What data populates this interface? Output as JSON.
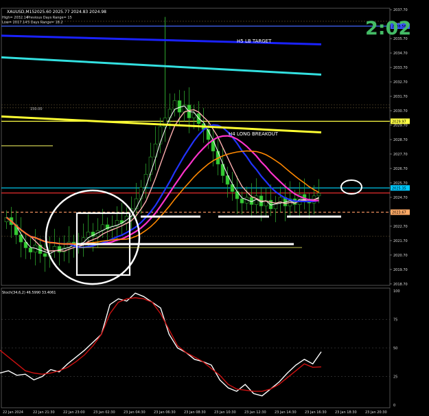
{
  "header": {
    "symbol": "XAUUSD,M15",
    "ohlc": "2025.60 2025.77 2024.83 2024.98",
    "info_high": "High= 2032.14",
    "info_prev": "Previous Days Range= 15",
    "info_low": "Low= 2017.14",
    "info_5d": "5 Days Range= 18.2",
    "countdown": "2:02",
    "indicator_title": "Stoch(34,6,2) 46.5990 33.4061"
  },
  "annotations": {
    "h5_target": "H5 LB TARGET",
    "h4_breakout": "H4 LONG BREAKOUT",
    "level_label": "150.00"
  },
  "chart_data": [
    {
      "type": "candlestick",
      "title": "XAUUSD,M15",
      "ylim": [
        2018.6,
        2037.8
      ],
      "y_ticks": [
        "2037.70",
        "2036.70",
        "2035.70",
        "2034.70",
        "2033.70",
        "2032.70",
        "2031.70",
        "2030.70",
        "2029.70",
        "2028.70",
        "2027.70",
        "2026.70",
        "2025.70",
        "2024.70",
        "2023.70",
        "2022.70",
        "2021.70",
        "2020.70",
        "2019.70",
        "2018.70"
      ],
      "price_tags": [
        {
          "value": "2036.56",
          "price": 2036.56,
          "color": "#3a55ff"
        },
        {
          "value": "2029.97",
          "price": 2029.97,
          "color": "#ffff44"
        },
        {
          "value": "2025.35",
          "price": 2025.35,
          "color": "#00c8ff"
        },
        {
          "value": "2023.67",
          "price": 2023.67,
          "color": "#ffaa66"
        }
      ],
      "x_ticks": [
        "22 Jan 2024",
        "22 Jan 21:30",
        "22 Jan 23:00",
        "23 Jan 02:30",
        "23 Jan 04:30",
        "23 Jan 06:30",
        "23 Jan 08:30",
        "23 Jan 10:30",
        "23 Jan 12:30",
        "23 Jan 14:30",
        "23 Jan 16:30",
        "23 Jan 18:30",
        "23 Jan 20:30"
      ],
      "closes": [
        2023.3,
        2022.8,
        2022.1,
        2021.6,
        2021.2,
        2020.9,
        2021.4,
        2020.8,
        2020.6,
        2021.0,
        2021.3,
        2020.9,
        2021.2,
        2021.6,
        2021.3,
        2021.5,
        2021.9,
        2022.3,
        2022.0,
        2022.4,
        2022.8,
        2022.5,
        2022.7,
        2023.1,
        2022.9,
        2023.4,
        2023.9,
        2024.6,
        2025.4,
        2026.3,
        2027.5,
        2028.4,
        2029.6,
        2030.2,
        2030.8,
        2031.4,
        2030.6,
        2031.1,
        2030.2,
        2030.5,
        2029.8,
        2029.4,
        2028.7,
        2027.9,
        2027.0,
        2026.2,
        2025.6,
        2025.1,
        2024.6,
        2024.3,
        2024.7,
        2024.2,
        2024.8,
        2024.1,
        2024.5,
        2023.9,
        2024.3,
        2024.7,
        2024.1,
        2024.6,
        2024.2,
        2024.9,
        2024.5,
        2024.3,
        2024.8,
        2024.98
      ],
      "vertical_lines": [
        {
          "name": "ema-blue",
          "color": "#1a22ff",
          "from": 2035.9,
          "to": 2035.3
        },
        {
          "name": "ema-cyan",
          "color": "#33e0e0",
          "from": 2034.4,
          "to": 2033.2
        },
        {
          "name": "ema-yellow",
          "color": "#ffff33",
          "from": 2030.3,
          "to": 2029.2
        }
      ],
      "levels": [
        {
          "price": 2036.56,
          "color": "#4466ff"
        },
        {
          "price": 2029.97,
          "color": "#ffff44"
        },
        {
          "price": 2025.35,
          "color": "#00d8ff"
        },
        {
          "price": 2023.67,
          "color": "#ff9966"
        },
        {
          "price": 2025.0,
          "color": "#ff3333"
        }
      ]
    },
    {
      "type": "line",
      "title": "Stoch(34,6,2) 46.5990 33.4061",
      "ylim": [
        0,
        100
      ],
      "y_ticks": [
        "100",
        "75",
        "50",
        "25",
        "0"
      ],
      "series": [
        {
          "color": "#ffffff",
          "values": [
            28,
            30,
            26,
            27,
            22,
            25,
            31,
            29,
            36,
            42,
            48,
            55,
            62,
            88,
            93,
            91,
            98,
            95,
            90,
            85,
            62,
            50,
            46,
            40,
            38,
            35,
            22,
            15,
            12,
            18,
            10,
            8,
            14,
            20,
            28,
            35,
            40,
            36,
            46.6
          ]
        },
        {
          "color": "#cc1111",
          "values": [
            48,
            42,
            36,
            30,
            28,
            27,
            28,
            30,
            33,
            38,
            44,
            52,
            62,
            80,
            90,
            93,
            94,
            93,
            90,
            80,
            66,
            52,
            46,
            42,
            38,
            32,
            26,
            18,
            14,
            13,
            12,
            12,
            14,
            18,
            24,
            30,
            36,
            33,
            33.4
          ]
        }
      ]
    }
  ]
}
